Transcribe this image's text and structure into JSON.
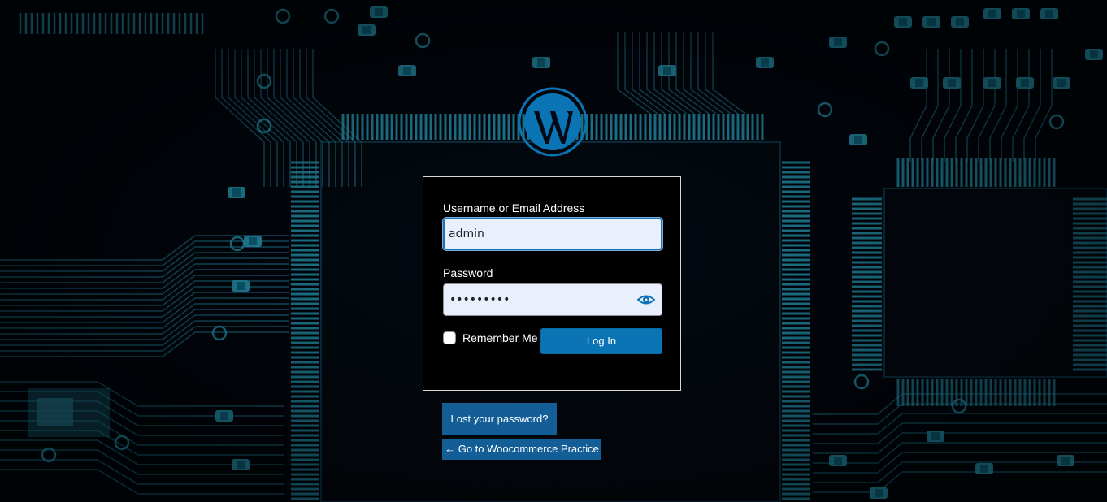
{
  "login_form": {
    "username_label": "Username or Email Address",
    "username_value": "admin",
    "password_label": "Password",
    "password_value": "•••••••••",
    "remember_label": "Remember Me",
    "remember_checked": false,
    "submit_label": "Log In"
  },
  "links": {
    "lost_password": "Lost your password?",
    "back_to_site": "← Go to Woocommerce Practice"
  },
  "icons": {
    "logo": "wordpress-logo-icon",
    "password_toggle": "eye-icon"
  },
  "colors": {
    "background": "#020915",
    "circuit_trace": "#2fb7d8",
    "accent": "#0a74b5",
    "link_bg": "#135e96",
    "field_bg": "#e9effb"
  }
}
